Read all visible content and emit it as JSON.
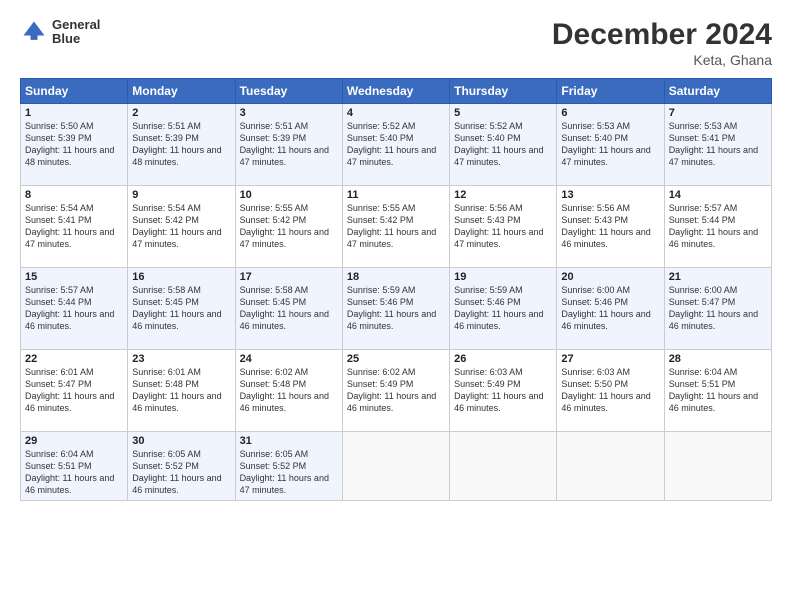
{
  "header": {
    "logo_line1": "General",
    "logo_line2": "Blue",
    "title": "December 2024",
    "subtitle": "Keta, Ghana"
  },
  "days_of_week": [
    "Sunday",
    "Monday",
    "Tuesday",
    "Wednesday",
    "Thursday",
    "Friday",
    "Saturday"
  ],
  "weeks": [
    [
      {
        "day": "1",
        "sunrise": "5:50 AM",
        "sunset": "5:39 PM",
        "daylight": "11 hours and 48 minutes."
      },
      {
        "day": "2",
        "sunrise": "5:51 AM",
        "sunset": "5:39 PM",
        "daylight": "11 hours and 48 minutes."
      },
      {
        "day": "3",
        "sunrise": "5:51 AM",
        "sunset": "5:39 PM",
        "daylight": "11 hours and 47 minutes."
      },
      {
        "day": "4",
        "sunrise": "5:52 AM",
        "sunset": "5:40 PM",
        "daylight": "11 hours and 47 minutes."
      },
      {
        "day": "5",
        "sunrise": "5:52 AM",
        "sunset": "5:40 PM",
        "daylight": "11 hours and 47 minutes."
      },
      {
        "day": "6",
        "sunrise": "5:53 AM",
        "sunset": "5:40 PM",
        "daylight": "11 hours and 47 minutes."
      },
      {
        "day": "7",
        "sunrise": "5:53 AM",
        "sunset": "5:41 PM",
        "daylight": "11 hours and 47 minutes."
      }
    ],
    [
      {
        "day": "8",
        "sunrise": "5:54 AM",
        "sunset": "5:41 PM",
        "daylight": "11 hours and 47 minutes."
      },
      {
        "day": "9",
        "sunrise": "5:54 AM",
        "sunset": "5:42 PM",
        "daylight": "11 hours and 47 minutes."
      },
      {
        "day": "10",
        "sunrise": "5:55 AM",
        "sunset": "5:42 PM",
        "daylight": "11 hours and 47 minutes."
      },
      {
        "day": "11",
        "sunrise": "5:55 AM",
        "sunset": "5:42 PM",
        "daylight": "11 hours and 47 minutes."
      },
      {
        "day": "12",
        "sunrise": "5:56 AM",
        "sunset": "5:43 PM",
        "daylight": "11 hours and 47 minutes."
      },
      {
        "day": "13",
        "sunrise": "5:56 AM",
        "sunset": "5:43 PM",
        "daylight": "11 hours and 46 minutes."
      },
      {
        "day": "14",
        "sunrise": "5:57 AM",
        "sunset": "5:44 PM",
        "daylight": "11 hours and 46 minutes."
      }
    ],
    [
      {
        "day": "15",
        "sunrise": "5:57 AM",
        "sunset": "5:44 PM",
        "daylight": "11 hours and 46 minutes."
      },
      {
        "day": "16",
        "sunrise": "5:58 AM",
        "sunset": "5:45 PM",
        "daylight": "11 hours and 46 minutes."
      },
      {
        "day": "17",
        "sunrise": "5:58 AM",
        "sunset": "5:45 PM",
        "daylight": "11 hours and 46 minutes."
      },
      {
        "day": "18",
        "sunrise": "5:59 AM",
        "sunset": "5:46 PM",
        "daylight": "11 hours and 46 minutes."
      },
      {
        "day": "19",
        "sunrise": "5:59 AM",
        "sunset": "5:46 PM",
        "daylight": "11 hours and 46 minutes."
      },
      {
        "day": "20",
        "sunrise": "6:00 AM",
        "sunset": "5:46 PM",
        "daylight": "11 hours and 46 minutes."
      },
      {
        "day": "21",
        "sunrise": "6:00 AM",
        "sunset": "5:47 PM",
        "daylight": "11 hours and 46 minutes."
      }
    ],
    [
      {
        "day": "22",
        "sunrise": "6:01 AM",
        "sunset": "5:47 PM",
        "daylight": "11 hours and 46 minutes."
      },
      {
        "day": "23",
        "sunrise": "6:01 AM",
        "sunset": "5:48 PM",
        "daylight": "11 hours and 46 minutes."
      },
      {
        "day": "24",
        "sunrise": "6:02 AM",
        "sunset": "5:48 PM",
        "daylight": "11 hours and 46 minutes."
      },
      {
        "day": "25",
        "sunrise": "6:02 AM",
        "sunset": "5:49 PM",
        "daylight": "11 hours and 46 minutes."
      },
      {
        "day": "26",
        "sunrise": "6:03 AM",
        "sunset": "5:49 PM",
        "daylight": "11 hours and 46 minutes."
      },
      {
        "day": "27",
        "sunrise": "6:03 AM",
        "sunset": "5:50 PM",
        "daylight": "11 hours and 46 minutes."
      },
      {
        "day": "28",
        "sunrise": "6:04 AM",
        "sunset": "5:51 PM",
        "daylight": "11 hours and 46 minutes."
      }
    ],
    [
      {
        "day": "29",
        "sunrise": "6:04 AM",
        "sunset": "5:51 PM",
        "daylight": "11 hours and 46 minutes."
      },
      {
        "day": "30",
        "sunrise": "6:05 AM",
        "sunset": "5:52 PM",
        "daylight": "11 hours and 46 minutes."
      },
      {
        "day": "31",
        "sunrise": "6:05 AM",
        "sunset": "5:52 PM",
        "daylight": "11 hours and 47 minutes."
      },
      null,
      null,
      null,
      null
    ]
  ]
}
